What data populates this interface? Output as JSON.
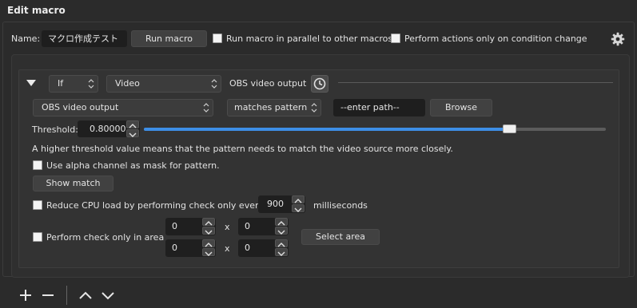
{
  "panel": {
    "title": "Edit macro"
  },
  "header": {
    "name_label": "Name:",
    "name_value": "マクロ作成テスト",
    "run_button": "Run macro",
    "parallel_label": "Run macro in parallel to other macros",
    "parallel_checked": false,
    "condition_change_label": "Perform actions only on condition change",
    "condition_change_checked": false,
    "settings_icon": "gear-icon"
  },
  "condition": {
    "collapse_icon": "triangle-down-icon",
    "logic": "If",
    "type": "Video",
    "summary": "OBS video output",
    "duration_icon": "clock-icon",
    "source": "OBS video output",
    "match_mode": "matches pattern",
    "path_value": "--enter path--",
    "browse_button": "Browse",
    "threshold_label": "Threshold:",
    "threshold_value": "0.80000",
    "threshold_fraction": 0.8,
    "threshold_hint": "A higher threshold value means that the pattern needs to match the video source more closely.",
    "alpha_label": "Use alpha channel as mask for pattern.",
    "alpha_checked": false,
    "show_match_button": "Show match",
    "reduce_cpu_label": "Reduce CPU load by performing check only every",
    "reduce_cpu_checked": false,
    "interval_value": "900",
    "interval_unit": "milliseconds",
    "area_label": "Perform check only in area",
    "area_checked": false,
    "area": {
      "x1": "0",
      "y1": "0",
      "x2": "0",
      "y2": "0",
      "sep": "x"
    },
    "select_area_button": "Select area"
  },
  "toolbar": {
    "add_icon": "plus-icon",
    "remove_icon": "minus-icon",
    "move_up_icon": "chevron-up-icon",
    "move_down_icon": "chevron-down-icon"
  },
  "colors": {
    "background": "#2b2b2b",
    "accent": "#3d8ee6",
    "field": "#1e1e1e"
  }
}
